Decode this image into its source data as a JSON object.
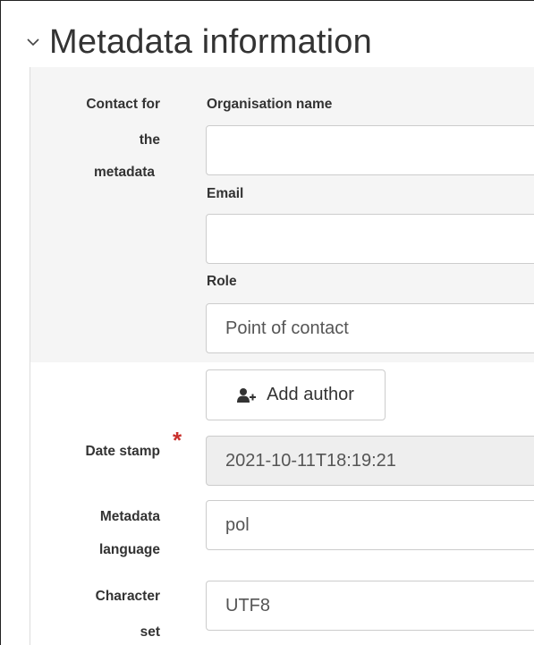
{
  "section": {
    "title": "Metadata information",
    "icon": "chevron-down-icon"
  },
  "contact": {
    "label_line1": "Contact for",
    "label_line2": "the",
    "label_line3": "metadata",
    "organisation_label": "Organisation name",
    "organisation_value": "",
    "email_label": "Email",
    "email_value": "",
    "role_label": "Role",
    "role_value": "Point of contact"
  },
  "add_author": {
    "label": "Add author",
    "icon": "add-user-icon"
  },
  "date_stamp": {
    "label": "Date stamp",
    "required_mark": "*",
    "value": "2021-10-11T18:19:21"
  },
  "metadata_language": {
    "label_line1": "Metadata",
    "label_line2": "language",
    "value": "pol"
  },
  "character_set": {
    "label_line1": "Character",
    "label_line2": "set",
    "value": "UTF8"
  },
  "colors": {
    "required": "#c9302c",
    "panel": "#f5f5f5",
    "disabled_input": "#eeeeee",
    "border": "#cccccc"
  }
}
